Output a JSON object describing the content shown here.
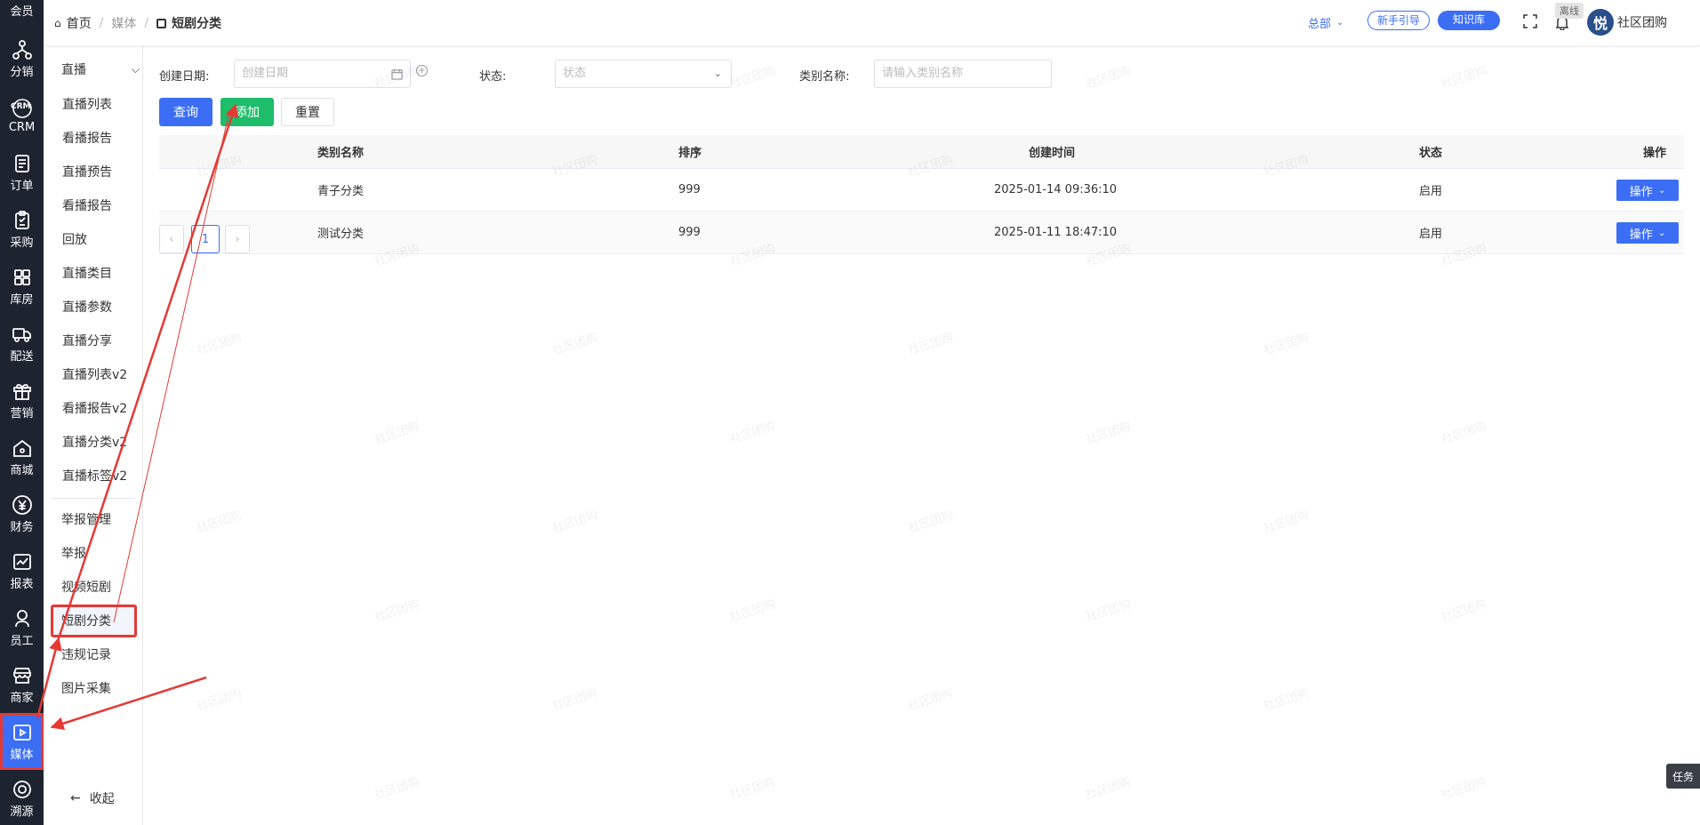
{
  "rail": {
    "items": [
      {
        "label": "会员",
        "icon": "member-icon"
      },
      {
        "label": "分销",
        "icon": "distribution-icon"
      },
      {
        "label": "CRM",
        "icon": "crm-icon"
      },
      {
        "label": "订单",
        "icon": "order-icon"
      },
      {
        "label": "采购",
        "icon": "purchase-icon"
      },
      {
        "label": "库房",
        "icon": "warehouse-icon"
      },
      {
        "label": "配送",
        "icon": "delivery-icon"
      },
      {
        "label": "营销",
        "icon": "gift-icon"
      },
      {
        "label": "商城",
        "icon": "home-icon"
      },
      {
        "label": "财务",
        "icon": "yen-icon"
      },
      {
        "label": "报表",
        "icon": "chart-icon"
      },
      {
        "label": "员工",
        "icon": "staff-icon"
      },
      {
        "label": "商家",
        "icon": "store-icon"
      },
      {
        "label": "媒体",
        "icon": "play-icon"
      },
      {
        "label": "溯源",
        "icon": "trace-icon"
      }
    ],
    "crm_glyph": "CRM"
  },
  "submenu": {
    "group_title": "直播",
    "items": [
      "直播列表",
      "看播报告",
      "直播预告",
      "看播报告",
      "回放",
      "直播类目",
      "直播参数",
      "直播分享",
      "直播列表v2",
      "看播报告v2",
      "直播分类v2",
      "直播标签v2"
    ],
    "items2": [
      "举报管理",
      "举报",
      "视频短剧",
      "短剧分类",
      "违规记录",
      "图片采集"
    ],
    "collapse": "收起"
  },
  "topbar": {
    "crumbs": [
      "首页",
      "媒体",
      "短剧分类"
    ],
    "org": "总部",
    "guide": "新手引导",
    "knowledge": "知识库",
    "offline": "离线",
    "avatar_char": "悦",
    "user": "社区团购"
  },
  "filters": {
    "date_label": "创建日期:",
    "date_placeholder": "创建日期",
    "status_label": "状态:",
    "status_placeholder": "状态",
    "name_label": "类别名称:",
    "name_placeholder": "请输入类别名称"
  },
  "buttons": {
    "query": "查询",
    "add": "添加",
    "reset": "重置"
  },
  "table": {
    "headers": [
      "类别名称",
      "排序",
      "创建时间",
      "状态",
      "操作"
    ],
    "rows": [
      {
        "name": "青子分类",
        "sort": "999",
        "created": "2025-01-14 09:36:10",
        "status": "启用",
        "op": "操作"
      },
      {
        "name": "测试分类",
        "sort": "999",
        "created": "2025-01-11 18:47:10",
        "status": "启用",
        "op": "操作"
      }
    ]
  },
  "pagination": {
    "current": "1"
  },
  "watermark": "社区团购",
  "task_tab": "任务",
  "colors": {
    "primary": "#3b6ef5",
    "success": "#1ebd6a",
    "rail_bg": "#1e2330",
    "annotation": "#e53935"
  }
}
